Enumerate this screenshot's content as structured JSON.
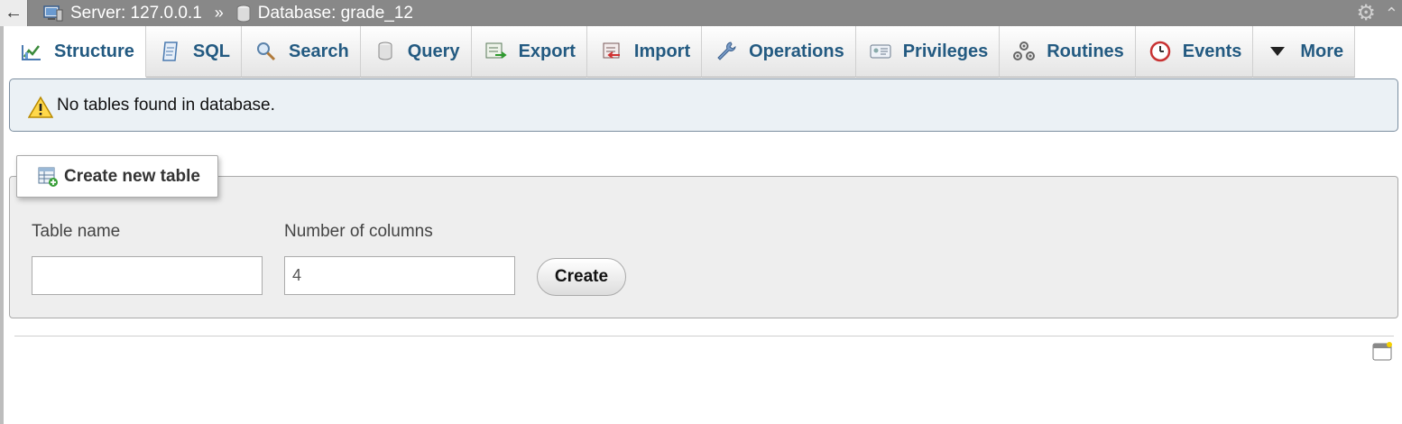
{
  "breadcrumb": {
    "back_glyph": "←",
    "server_label": "Server: 127.0.0.1",
    "separator": "»",
    "database_label": "Database: grade_12"
  },
  "tabs": [
    {
      "label": "Structure",
      "icon": "structure-icon",
      "active": true
    },
    {
      "label": "SQL",
      "icon": "sql-icon"
    },
    {
      "label": "Search",
      "icon": "search-icon"
    },
    {
      "label": "Query",
      "icon": "query-icon"
    },
    {
      "label": "Export",
      "icon": "export-icon"
    },
    {
      "label": "Import",
      "icon": "import-icon"
    },
    {
      "label": "Operations",
      "icon": "wrench-icon"
    },
    {
      "label": "Privileges",
      "icon": "privileges-icon"
    },
    {
      "label": "Routines",
      "icon": "routines-icon"
    },
    {
      "label": "Events",
      "icon": "clock-icon"
    },
    {
      "label": "More",
      "icon": "triangle-down-icon"
    }
  ],
  "notice": {
    "text": "No tables found in database.",
    "icon": "warning-icon",
    "color_bg": "#ebf1f5"
  },
  "create_table": {
    "legend": "Create new table",
    "table_name_label": "Table name",
    "table_name_value": "",
    "columns_label": "Number of columns",
    "columns_value": "4",
    "create_button": "Create"
  },
  "colors": {
    "topbar": "#888888",
    "tab_text": "#235a81"
  }
}
